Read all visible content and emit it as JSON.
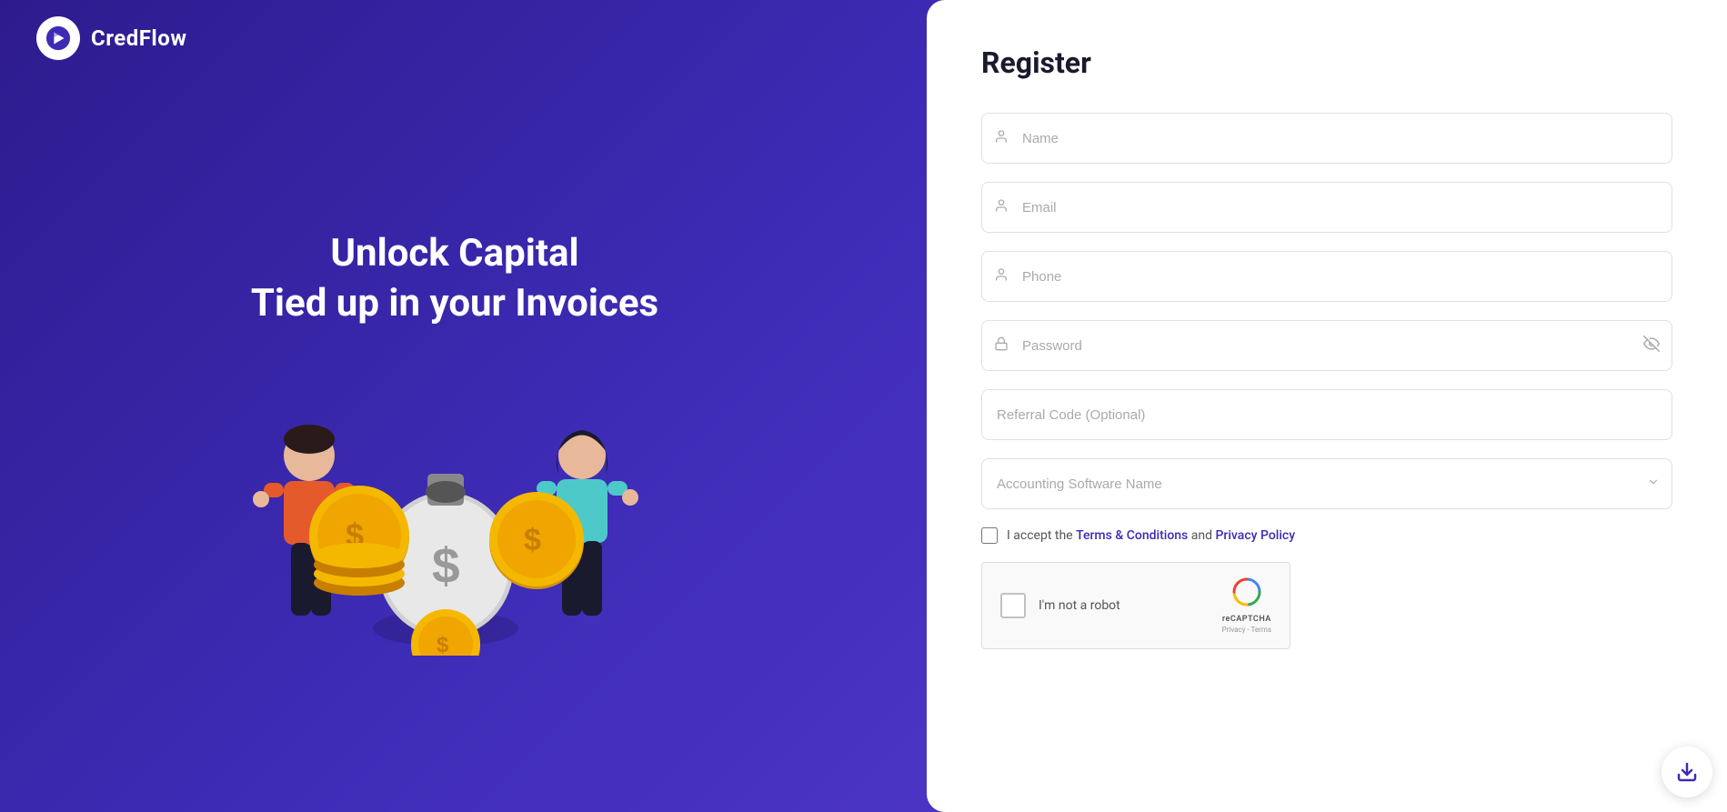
{
  "brand": {
    "name": "CredFlow",
    "logo_unicode": "▶"
  },
  "hero": {
    "line1": "Unlock Capital",
    "line2": "Tied up in your Invoices"
  },
  "form": {
    "title": "Register",
    "fields": {
      "name_placeholder": "Name",
      "email_placeholder": "Email",
      "phone_placeholder": "Phone",
      "password_placeholder": "Password",
      "referral_placeholder": "Referral Code (Optional)",
      "accounting_placeholder": "Accounting Software Name"
    },
    "terms": {
      "prefix": "I accept the",
      "terms_link": "Terms & Conditions",
      "connector": "and",
      "privacy_link": "Privacy Policy"
    },
    "recaptcha": {
      "label": "I'm not a robot",
      "brand": "reCAPTCHA",
      "sub": "Privacy - Terms"
    }
  },
  "icons": {
    "person": "👤",
    "lock": "🔒",
    "eye_slash": "👁",
    "chevron_down": "⌄",
    "download": "⬇"
  }
}
